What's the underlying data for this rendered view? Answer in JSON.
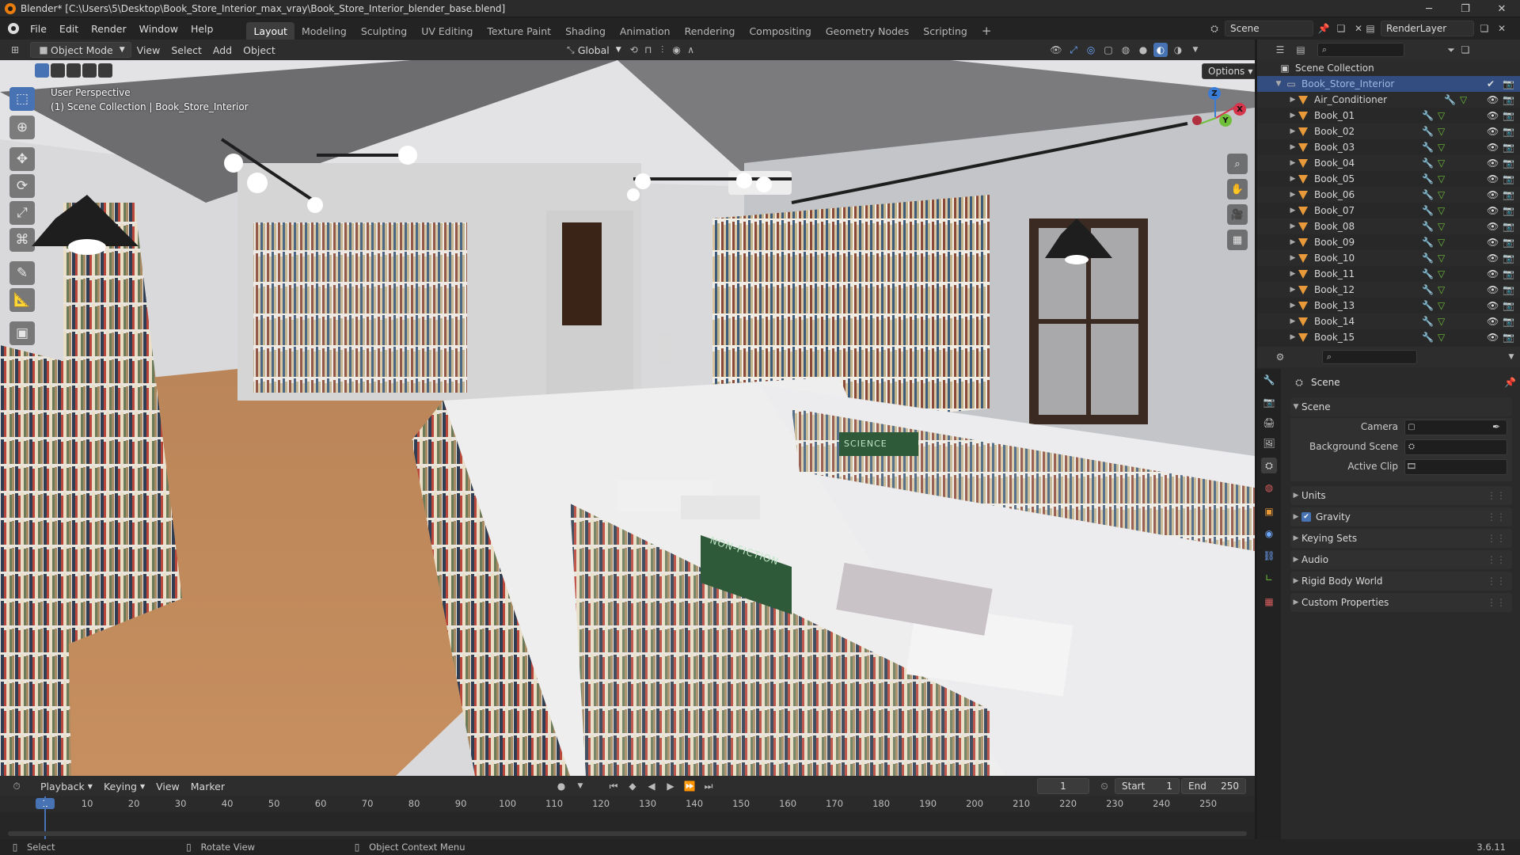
{
  "window": {
    "title": "Blender* [C:\\Users\\5\\Desktop\\Book_Store_Interior_max_vray\\Book_Store_Interior_blender_base.blend]"
  },
  "menu": [
    "File",
    "Edit",
    "Render",
    "Window",
    "Help"
  ],
  "workspaces": [
    "Layout",
    "Modeling",
    "Sculpting",
    "UV Editing",
    "Texture Paint",
    "Shading",
    "Animation",
    "Rendering",
    "Compositing",
    "Geometry Nodes",
    "Scripting"
  ],
  "scene_name": "Scene",
  "render_layer": "RenderLayer",
  "viewport_header": {
    "mode": "Object Mode",
    "menus": [
      "View",
      "Select",
      "Add",
      "Object"
    ],
    "transform": "Global",
    "options": "Options"
  },
  "viewport": {
    "perspective": "User Perspective",
    "collection": "(1) Scene Collection | Book_Store_Interior",
    "signs": {
      "sign1": "NON-FICTION",
      "sign2": "SCIENCE"
    }
  },
  "gizmo": {
    "x": "X",
    "y": "Y",
    "z": "Z"
  },
  "outliner": {
    "root": "Scene Collection",
    "collection": "Book_Store_Interior",
    "items": [
      "Air_Conditioner",
      "Book_01",
      "Book_02",
      "Book_03",
      "Book_04",
      "Book_05",
      "Book_06",
      "Book_07",
      "Book_08",
      "Book_09",
      "Book_10",
      "Book_11",
      "Book_12",
      "Book_13",
      "Book_14",
      "Book_15"
    ]
  },
  "properties": {
    "header": "Scene",
    "section": "Scene",
    "camera_label": "Camera",
    "background_label": "Background Scene",
    "active_clip_label": "Active Clip",
    "panels": [
      "Units",
      "Gravity",
      "Keying Sets",
      "Audio",
      "Rigid Body World",
      "Custom Properties"
    ],
    "gravity_checked": true
  },
  "timeline": {
    "menus": [
      "Playback",
      "Keying",
      "View",
      "Marker"
    ],
    "current_frame": "1",
    "start_label": "Start",
    "start": "1",
    "end_label": "End",
    "end": "250",
    "ticks": [
      "1",
      "10",
      "20",
      "30",
      "40",
      "50",
      "60",
      "70",
      "80",
      "90",
      "100",
      "110",
      "120",
      "130",
      "140",
      "150",
      "160",
      "170",
      "180",
      "190",
      "200",
      "210",
      "220",
      "230",
      "240",
      "250"
    ]
  },
  "statusbar": {
    "select": "Select",
    "rotate": "Rotate View",
    "context": "Object Context Menu",
    "version": "3.6.11"
  }
}
